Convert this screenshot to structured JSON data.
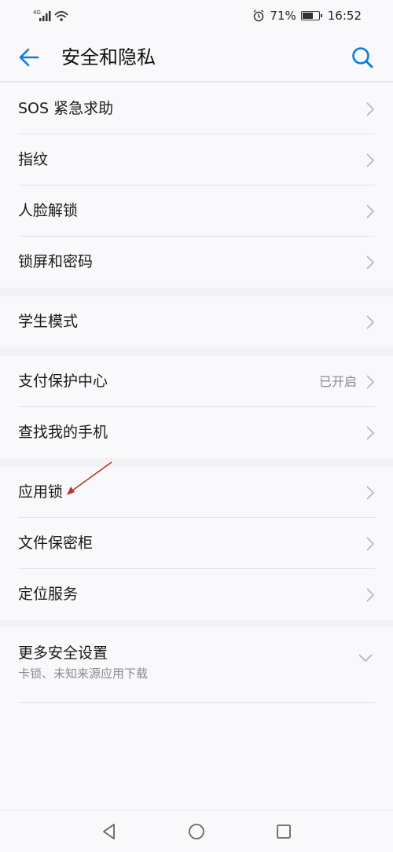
{
  "status_bar": {
    "network": "4G",
    "battery_percent": "71%",
    "battery_level": 0.71,
    "time": "16:52"
  },
  "header": {
    "title": "安全和隐私"
  },
  "groups": [
    {
      "items": [
        {
          "label": "SOS 紧急求助"
        },
        {
          "label": "指纹"
        },
        {
          "label": "人脸解锁"
        },
        {
          "label": "锁屏和密码"
        }
      ]
    },
    {
      "items": [
        {
          "label": "学生模式"
        }
      ]
    },
    {
      "items": [
        {
          "label": "支付保护中心",
          "value": "已开启"
        },
        {
          "label": "查找我的手机"
        }
      ]
    },
    {
      "items": [
        {
          "label": "应用锁"
        },
        {
          "label": "文件保密柜"
        },
        {
          "label": "定位服务"
        }
      ]
    }
  ],
  "more_settings": {
    "label": "更多安全设置",
    "subtitle": "卡锁、未知来源应用下载"
  },
  "colors": {
    "accent": "#0a7dd8",
    "background": "#f2f2f4",
    "surface": "#f9f8fb",
    "annotation": "#b13a2c"
  }
}
